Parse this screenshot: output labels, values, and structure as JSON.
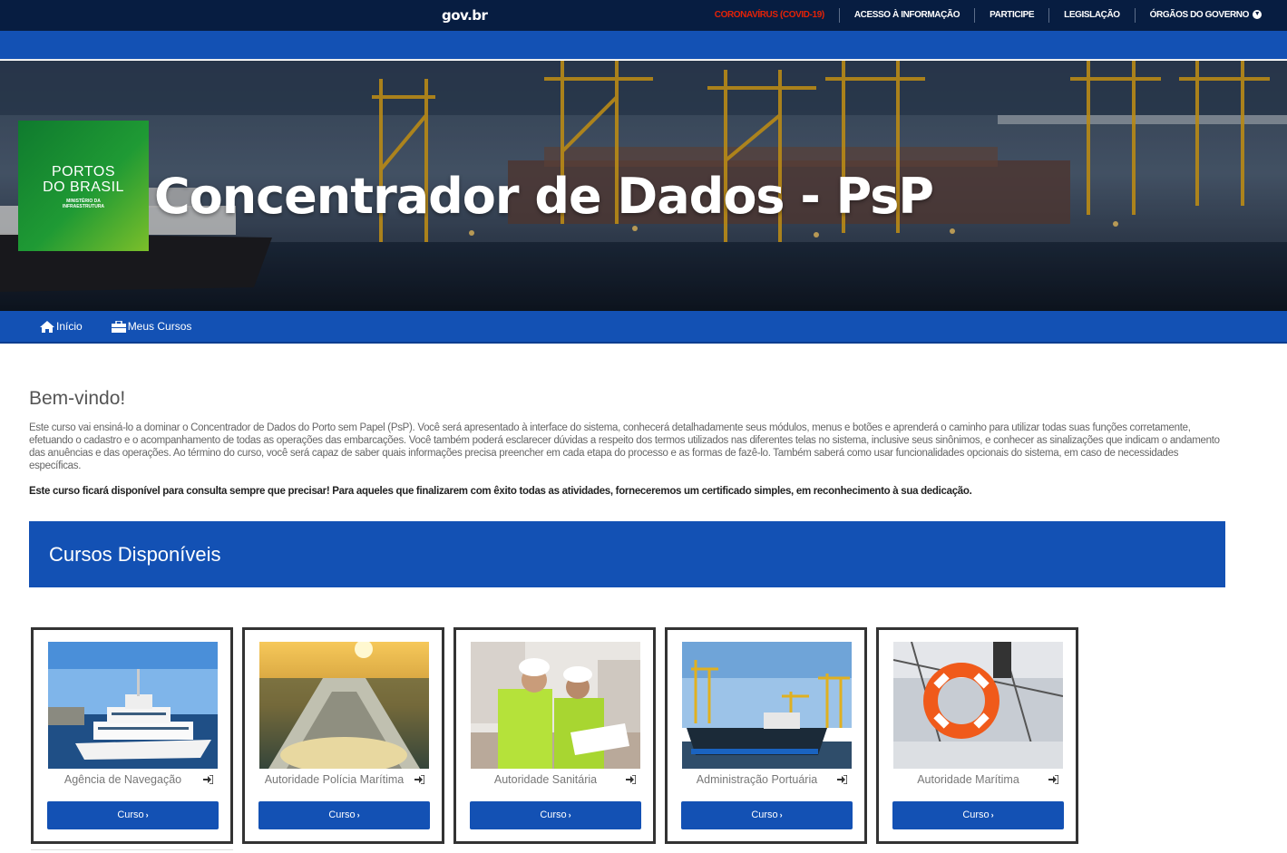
{
  "govbar": {
    "logo": "gov.br",
    "links": [
      {
        "label": "CORONAVÍRUS (COVID-19)"
      },
      {
        "label": "ACESSO À INFORMAÇÃO"
      },
      {
        "label": "PARTICIPE"
      },
      {
        "label": "LEGISLAÇÃO"
      },
      {
        "label": "ÓRGÃOS DO GOVERNO"
      }
    ],
    "colors": {
      "bar": "#071d41",
      "covid": "#e52207"
    }
  },
  "hero": {
    "logo_line1": "PORTOS",
    "logo_line2": "DO BRASIL",
    "logo_line3": "MINISTÉRIO DA",
    "logo_line4": "INFRAESTRUTURA",
    "title": "Concentrador de Dados - PsP"
  },
  "nav": {
    "items": [
      {
        "label": "Início",
        "icon": "home-icon"
      },
      {
        "label": "Meus Cursos",
        "icon": "briefcase-icon"
      }
    ]
  },
  "welcome": {
    "title": "Bem-vindo!",
    "text": "Este curso vai ensiná-lo a dominar o Concentrador de Dados do Porto sem Papel (PsP). Você será apresentado à interface do sistema, conhecerá detalhadamente seus módulos, menus e botões e aprenderá o caminho para utilizar todas suas funções corretamente, efetuando o cadastro e o acompanhamento de todas as operações das embarcações. Você também poderá esclarecer dúvidas a respeito dos termos utilizados nas diferentes telas no sistema, inclusive seus sinônimos, e conhecer as sinalizações que indicam o andamento das anuências e das operações. Ao término do curso, você será capaz de saber quais informações precisa preencher em cada etapa do processo e as formas de fazê-lo. Também saberá como usar funcionalidades opcionais do sistema, em caso de necessidades específicas.",
    "bold_text": "Este curso ficará disponível para consulta sempre que precisar! Para aqueles que finalizarem com êxito todas as atividades, forneceremos um certificado simples, em reconhecimento à sua dedicação."
  },
  "cursos": {
    "title": "Cursos Disponíveis",
    "button_label": "Curso",
    "button_chevron": "›",
    "items": [
      {
        "name": "Agência de Navegação"
      },
      {
        "name": "Autoridade Polícia Marítima"
      },
      {
        "name": "Autoridade Sanitária"
      },
      {
        "name": "Administração Portuária"
      },
      {
        "name": "Autoridade Marítima"
      }
    ]
  },
  "colors": {
    "primary": "#1351b4",
    "dark": "#071d41"
  }
}
